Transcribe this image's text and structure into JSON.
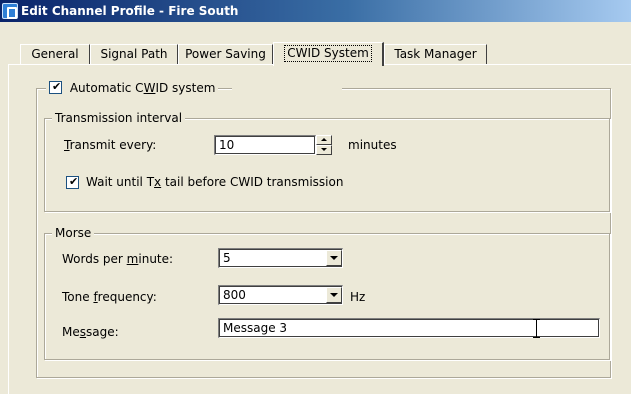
{
  "window": {
    "title": "Edit Channel Profile - Fire South"
  },
  "tabs": [
    "General",
    "Signal Path",
    "Power Saving",
    "CWID System",
    "Task Manager"
  ],
  "active_tab": "CWID System",
  "cwid": {
    "auto_label_pre": "Automatic C",
    "auto_label_ul": "W",
    "auto_label_post": "ID system",
    "auto_checked": true
  },
  "transmission": {
    "legend": "Transmission interval",
    "transmit_ul": "T",
    "transmit_rest": "ransmit every:",
    "interval_value": "10",
    "units": "minutes",
    "wait_pre": "Wait until T",
    "wait_ul": "x",
    "wait_post": " tail before CWID transmission",
    "wait_checked": true
  },
  "morse": {
    "legend": "Morse",
    "wpm_pre": "Words per ",
    "wpm_ul": "m",
    "wpm_post": "inute:",
    "wpm_value": "5",
    "tone_pre": "Tone ",
    "tone_ul": "f",
    "tone_post": "requency:",
    "tone_value": "800",
    "tone_units": "Hz",
    "msg_pre": "Me",
    "msg_ul": "s",
    "msg_post": "sage:",
    "msg_value": "Message 3"
  },
  "colors": {
    "titlebar_start": "#0a246a",
    "titlebar_end": "#a6caf0",
    "face": "#ece9d8"
  }
}
